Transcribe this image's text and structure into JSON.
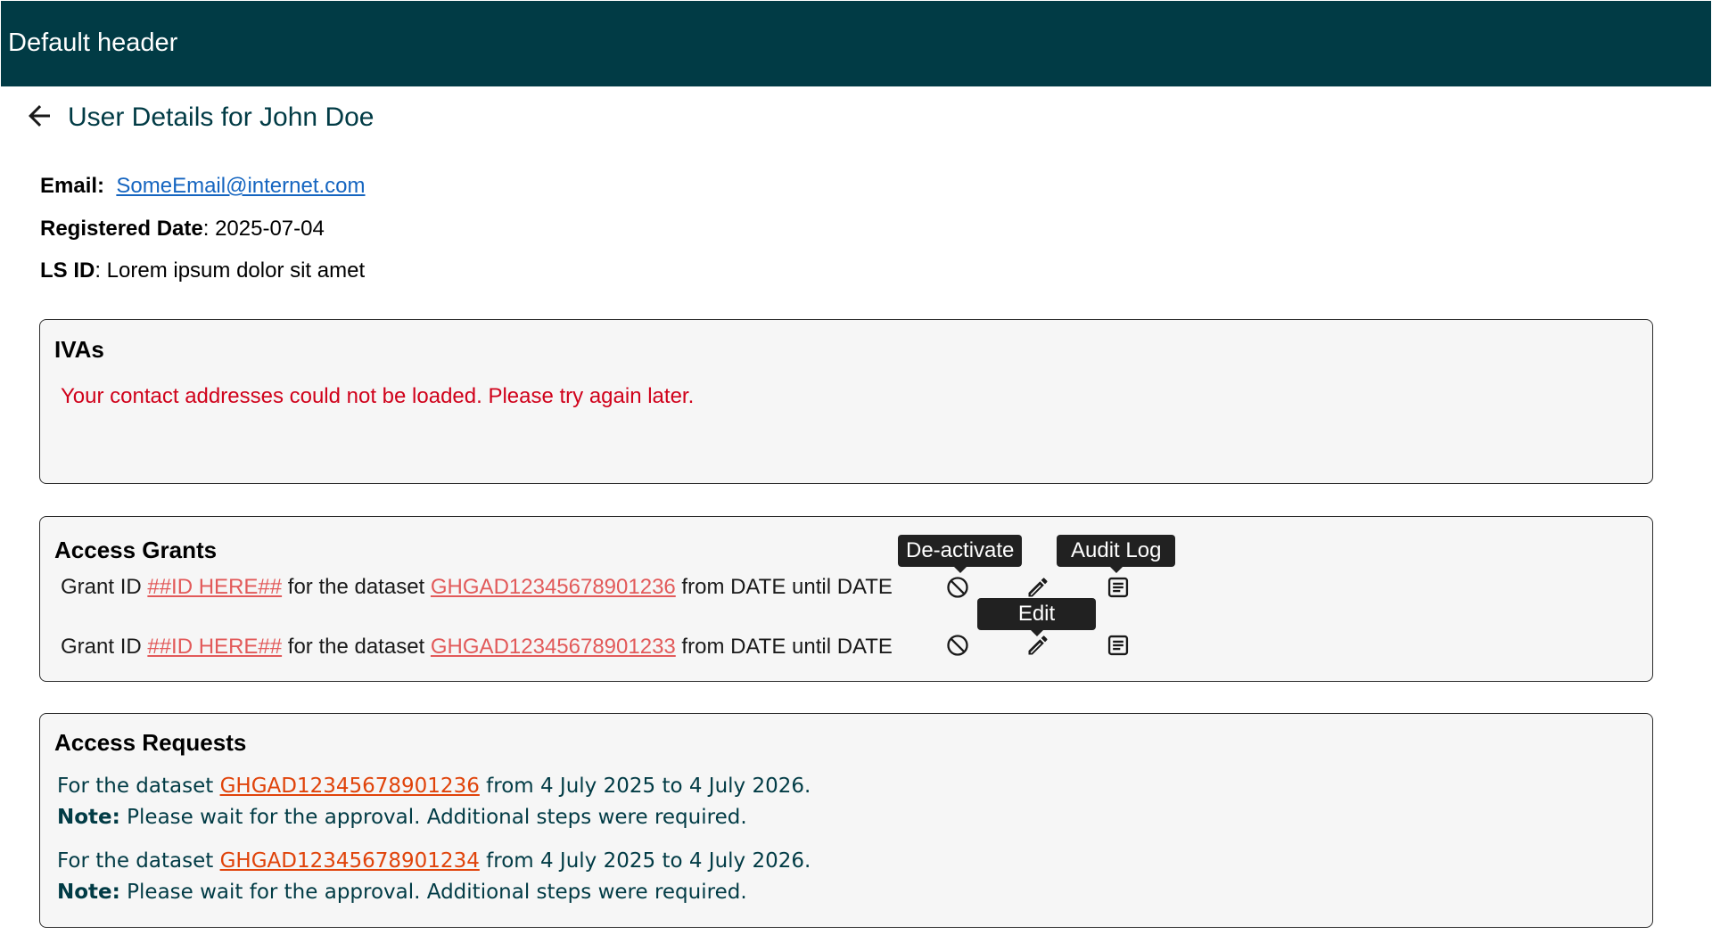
{
  "header": {
    "title": "Default header"
  },
  "page": {
    "title": "User Details for John Doe",
    "back_icon": "arrow-left-icon"
  },
  "user": {
    "email_label": "Email:",
    "email": "SomeEmail@internet.com",
    "registered_label": "Registered Date",
    "registered_value": ": 2025-07-04",
    "lsid_label": "LS ID",
    "lsid_value": ": Lorem ipsum dolor sit amet"
  },
  "ivas": {
    "title": "IVAs",
    "error": "Your contact addresses could not be loaded. Please try again later."
  },
  "grants": {
    "title": "Access Grants",
    "rows": [
      {
        "prefix": "Grant ID ",
        "grant_id": "##ID HERE##",
        "middle": " for the dataset ",
        "dataset": "GHGAD12345678901236",
        "suffix": " from DATE until DATE"
      },
      {
        "prefix": "Grant ID ",
        "grant_id": "##ID HERE##",
        "middle": " for the dataset ",
        "dataset": "GHGAD12345678901233",
        "suffix": " from DATE until DATE"
      }
    ],
    "tooltips": {
      "deactivate": "De-activate",
      "audit": "Audit Log",
      "edit": "Edit"
    },
    "icons": [
      "block-icon",
      "pencil-icon",
      "document-list-icon"
    ]
  },
  "requests": {
    "title": "Access Requests",
    "items": [
      {
        "prefix": "For the dataset ",
        "dataset": "GHGAD12345678901236",
        "suffix": " from 4 July 2025 to 4 July 2026.",
        "note_label": "Note:",
        "note_text": " Please wait for the approval. Additional steps were required."
      },
      {
        "prefix": "For the dataset ",
        "dataset": "GHGAD12345678901234",
        "suffix": " from 4 July 2025 to 4 July 2026.",
        "note_label": "Note:",
        "note_text": " Please wait for the approval. Additional steps were required."
      }
    ]
  },
  "colors": {
    "header_bg": "#013b45",
    "error": "#d0021b",
    "link_blue": "#1565c0",
    "link_red": "#e25a5a",
    "link_orange": "#e0430a"
  }
}
